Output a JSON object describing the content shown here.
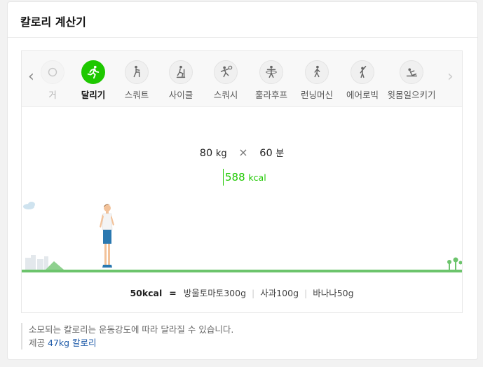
{
  "widget": {
    "title": "칼로리 계산기"
  },
  "exercises": [
    {
      "label": "거",
      "icon": "cycling-partial-icon",
      "state": "faded"
    },
    {
      "label": "달리기",
      "icon": "running-icon",
      "state": "active"
    },
    {
      "label": "스쿼트",
      "icon": "squat-icon",
      "state": "normal"
    },
    {
      "label": "사이클",
      "icon": "cycle-icon",
      "state": "normal"
    },
    {
      "label": "스쿼시",
      "icon": "squash-icon",
      "state": "normal"
    },
    {
      "label": "훌라후프",
      "icon": "hula-hoop-icon",
      "state": "normal"
    },
    {
      "label": "런닝머신",
      "icon": "treadmill-icon",
      "state": "normal"
    },
    {
      "label": "에어로빅",
      "icon": "aerobics-icon",
      "state": "normal"
    },
    {
      "label": "윗몸일으키기",
      "icon": "situp-icon",
      "state": "normal"
    }
  ],
  "calc": {
    "weight": "80",
    "weight_unit": "kg",
    "times": "×",
    "duration": "60",
    "duration_unit": "분",
    "kcal": "588",
    "kcal_unit": "kcal"
  },
  "equivalents": {
    "base": "50kcal",
    "equals": "=",
    "items": [
      "방울토마토300g",
      "사과100g",
      "바나나50g"
    ],
    "separator": "|"
  },
  "note": {
    "line1": "소모되는 칼로리는 운동강도에 따라 달라질 수 있습니다.",
    "provider_prefix": "제공",
    "provider_link": "47kg 칼로리"
  },
  "colors": {
    "accent": "#1ec800",
    "ground": "#6cc46c",
    "link": "#1e5aa8"
  }
}
